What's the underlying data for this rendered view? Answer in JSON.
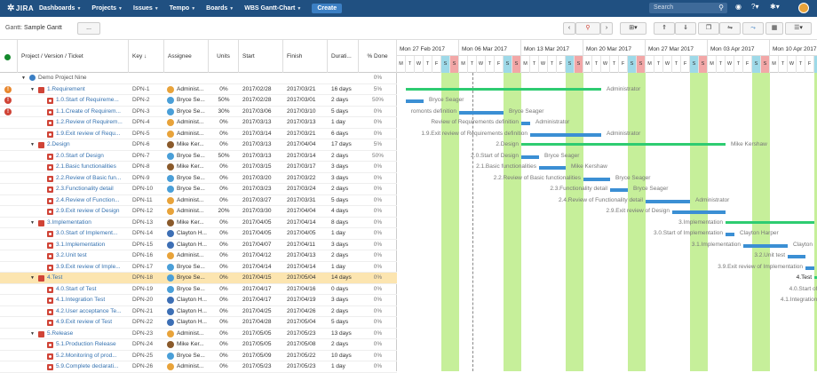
{
  "nav": {
    "logo": "JIRA",
    "items": [
      "Dashboards",
      "Projects",
      "Issues",
      "Tempo",
      "Boards",
      "WBS Gantt-Chart"
    ],
    "create": "Create",
    "search_placeholder": "Search"
  },
  "toolbar": {
    "gantt_label": "Gantt:",
    "gantt_name": "Sample Gantt",
    "dropdown": "..."
  },
  "columns": {
    "project": "Project / Version / Ticket",
    "key": "Key",
    "sort": "↓",
    "assignee": "Assignee",
    "units": "Units",
    "start": "Start",
    "finish": "Finish",
    "duration": "Durati...",
    "done": "% Done"
  },
  "weeks": [
    "Mon 27 Feb 2017",
    "Mon 06 Mar 2017",
    "Mon 13 Mar 2017",
    "Mon 20 Mar 2017",
    "Mon 27 Mar 2017",
    "Mon 03 Apr 2017",
    "Mon 10 Apr 2017"
  ],
  "day_letters": [
    "M",
    "T",
    "W",
    "T",
    "F",
    "S",
    "S"
  ],
  "colors": {
    "nav": "#205081",
    "weekend": "#c6ef9a",
    "task_bar": "#3b8fd4",
    "summary_bar": "#2ecc71",
    "selected": "#fce5b0"
  },
  "rows": [
    {
      "name": "Demo Project Nine",
      "key": "",
      "assignee": "",
      "units": "",
      "start": "",
      "finish": "",
      "duration": "",
      "done": "0%",
      "level": 0,
      "kind": "project",
      "warn": ""
    },
    {
      "name": "1.Requirement",
      "key": "DPN-1",
      "assignee": "Administ...",
      "units": "0%",
      "start": "2017/02/28",
      "finish": "2017/03/21",
      "duration": "16 days",
      "done": "5%",
      "level": 1,
      "kind": "epic",
      "warn": "o"
    },
    {
      "name": "1.0.Start of Requireme...",
      "key": "DPN-2",
      "assignee": "Bryce Se...",
      "units": "50%",
      "start": "2017/02/28",
      "finish": "2017/03/01",
      "duration": "2 days",
      "done": "50%",
      "level": 2,
      "kind": "issue",
      "warn": "r"
    },
    {
      "name": "1.1.Create of Requirem...",
      "key": "DPN-3",
      "assignee": "Bryce Se...",
      "units": "30%",
      "start": "2017/03/06",
      "finish": "2017/03/10",
      "duration": "5 days",
      "done": "0%",
      "level": 2,
      "kind": "issue",
      "warn": "r"
    },
    {
      "name": "1.2.Review of Requirem...",
      "key": "DPN-4",
      "assignee": "Administ...",
      "units": "0%",
      "start": "2017/03/13",
      "finish": "2017/03/13",
      "duration": "1 day",
      "done": "0%",
      "level": 2,
      "kind": "issue",
      "warn": ""
    },
    {
      "name": "1.9.Exit review of Requ...",
      "key": "DPN-5",
      "assignee": "Administ...",
      "units": "0%",
      "start": "2017/03/14",
      "finish": "2017/03/21",
      "duration": "6 days",
      "done": "0%",
      "level": 2,
      "kind": "issue",
      "warn": ""
    },
    {
      "name": "2.Design",
      "key": "DPN-6",
      "assignee": "Mike Ker...",
      "units": "0%",
      "start": "2017/03/13",
      "finish": "2017/04/04",
      "duration": "17 days",
      "done": "5%",
      "level": 1,
      "kind": "epic",
      "warn": ""
    },
    {
      "name": "2.0.Start of Design",
      "key": "DPN-7",
      "assignee": "Bryce Se...",
      "units": "50%",
      "start": "2017/03/13",
      "finish": "2017/03/14",
      "duration": "2 days",
      "done": "50%",
      "level": 2,
      "kind": "issue",
      "warn": ""
    },
    {
      "name": "2.1.Basic functionalities",
      "key": "DPN-8",
      "assignee": "Mike Ker...",
      "units": "0%",
      "start": "2017/03/15",
      "finish": "2017/03/17",
      "duration": "3 days",
      "done": "0%",
      "level": 2,
      "kind": "issue",
      "warn": ""
    },
    {
      "name": "2.2.Review of Basic fun...",
      "key": "DPN-9",
      "assignee": "Bryce Se...",
      "units": "0%",
      "start": "2017/03/20",
      "finish": "2017/03/22",
      "duration": "3 days",
      "done": "0%",
      "level": 2,
      "kind": "issue",
      "warn": ""
    },
    {
      "name": "2.3.Functionality detail",
      "key": "DPN-10",
      "assignee": "Bryce Se...",
      "units": "0%",
      "start": "2017/03/23",
      "finish": "2017/03/24",
      "duration": "2 days",
      "done": "0%",
      "level": 2,
      "kind": "issue",
      "warn": ""
    },
    {
      "name": "2.4.Review of Function...",
      "key": "DPN-11",
      "assignee": "Administ...",
      "units": "0%",
      "start": "2017/03/27",
      "finish": "2017/03/31",
      "duration": "5 days",
      "done": "0%",
      "level": 2,
      "kind": "issue",
      "warn": ""
    },
    {
      "name": "2.9.Exit review of Design",
      "key": "DPN-12",
      "assignee": "Administ...",
      "units": "20%",
      "start": "2017/03/30",
      "finish": "2017/04/04",
      "duration": "4 days",
      "done": "0%",
      "level": 2,
      "kind": "issue",
      "warn": ""
    },
    {
      "name": "3.Implementation",
      "key": "DPN-13",
      "assignee": "Mike Ker...",
      "units": "0%",
      "start": "2017/04/05",
      "finish": "2017/04/14",
      "duration": "8 days",
      "done": "0%",
      "level": 1,
      "kind": "epic",
      "warn": ""
    },
    {
      "name": "3.0.Start of Implement...",
      "key": "DPN-14",
      "assignee": "Clayton H...",
      "units": "0%",
      "start": "2017/04/05",
      "finish": "2017/04/05",
      "duration": "1 day",
      "done": "0%",
      "level": 2,
      "kind": "issue",
      "warn": ""
    },
    {
      "name": "3.1.Implementation",
      "key": "DPN-15",
      "assignee": "Clayton H...",
      "units": "0%",
      "start": "2017/04/07",
      "finish": "2017/04/11",
      "duration": "3 days",
      "done": "0%",
      "level": 2,
      "kind": "issue",
      "warn": ""
    },
    {
      "name": "3.2.Unit test",
      "key": "DPN-16",
      "assignee": "Administ...",
      "units": "0%",
      "start": "2017/04/12",
      "finish": "2017/04/13",
      "duration": "2 days",
      "done": "0%",
      "level": 2,
      "kind": "issue",
      "warn": ""
    },
    {
      "name": "3.9.Exit review of Imple...",
      "key": "DPN-17",
      "assignee": "Bryce Se...",
      "units": "0%",
      "start": "2017/04/14",
      "finish": "2017/04/14",
      "duration": "1 day",
      "done": "0%",
      "level": 2,
      "kind": "issue",
      "warn": ""
    },
    {
      "name": "4.Test",
      "key": "DPN-18",
      "assignee": "Bryce Se...",
      "units": "0%",
      "start": "2017/04/15",
      "finish": "2017/05/04",
      "duration": "14 days",
      "done": "0%",
      "level": 1,
      "kind": "epic",
      "warn": "",
      "selected": true
    },
    {
      "name": "4.0.Start of Test",
      "key": "DPN-19",
      "assignee": "Bryce Se...",
      "units": "0%",
      "start": "2017/04/17",
      "finish": "2017/04/16",
      "duration": "0 days",
      "done": "0%",
      "level": 2,
      "kind": "issue",
      "warn": ""
    },
    {
      "name": "4.1.Integration Test",
      "key": "DPN-20",
      "assignee": "Clayton H...",
      "units": "0%",
      "start": "2017/04/17",
      "finish": "2017/04/19",
      "duration": "3 days",
      "done": "0%",
      "level": 2,
      "kind": "issue",
      "warn": ""
    },
    {
      "name": "4.2.User acceptance Te...",
      "key": "DPN-21",
      "assignee": "Clayton H...",
      "units": "0%",
      "start": "2017/04/25",
      "finish": "2017/04/26",
      "duration": "2 days",
      "done": "0%",
      "level": 2,
      "kind": "issue",
      "warn": ""
    },
    {
      "name": "4.9.Exit review of Test",
      "key": "DPN-22",
      "assignee": "Clayton H...",
      "units": "0%",
      "start": "2017/04/28",
      "finish": "2017/05/04",
      "duration": "5 days",
      "done": "0%",
      "level": 2,
      "kind": "issue",
      "warn": ""
    },
    {
      "name": "5.Release",
      "key": "DPN-23",
      "assignee": "Administ...",
      "units": "0%",
      "start": "2017/05/05",
      "finish": "2017/05/23",
      "duration": "13 days",
      "done": "0%",
      "level": 1,
      "kind": "epic",
      "warn": ""
    },
    {
      "name": "5.1.Production Release",
      "key": "DPN-24",
      "assignee": "Mike Ker...",
      "units": "0%",
      "start": "2017/05/05",
      "finish": "2017/05/08",
      "duration": "2 days",
      "done": "0%",
      "level": 2,
      "kind": "issue",
      "warn": ""
    },
    {
      "name": "5.2.Monitoring of prod...",
      "key": "DPN-25",
      "assignee": "Bryce Se...",
      "units": "0%",
      "start": "2017/05/09",
      "finish": "2017/05/22",
      "duration": "10 days",
      "done": "0%",
      "level": 2,
      "kind": "issue",
      "warn": ""
    },
    {
      "name": "5.9.Complete declarati...",
      "key": "DPN-26",
      "assignee": "Administ...",
      "units": "0%",
      "start": "2017/05/23",
      "finish": "2017/05/23",
      "duration": "1 day",
      "done": "0%",
      "level": 2,
      "kind": "issue",
      "warn": ""
    }
  ],
  "gantt_labels": [
    {
      "row": 1,
      "text": "Administrator"
    },
    {
      "row": 2,
      "text": "Bryce Seager"
    },
    {
      "row": 3,
      "text": "Bryce Seager"
    },
    {
      "row": 4,
      "text": "Administrator"
    },
    {
      "row": 5,
      "text": "Administrator"
    },
    {
      "row": 6,
      "text": "Mike Kershaw"
    },
    {
      "row": 7,
      "text": "Bryce Seager"
    },
    {
      "row": 8,
      "text": "Mike Kershaw"
    },
    {
      "row": 9,
      "text": "Bryce Seager"
    },
    {
      "row": 10,
      "text": "Bryce Seager"
    },
    {
      "row": 11,
      "text": "Administrator"
    },
    {
      "row": 13,
      "text": "Mike Kershaw"
    },
    {
      "row": 14,
      "text": "Clayton Harper"
    },
    {
      "row": 15,
      "text": "Clayton"
    }
  ],
  "gantt_prefix_labels": [
    {
      "row": 3,
      "text": "romonts definition"
    },
    {
      "row": 4,
      "text": "Review of Requirements definition"
    },
    {
      "row": 5,
      "text": "1.9.Exit review of Requirements definition"
    },
    {
      "row": 6,
      "text": "2.Design"
    },
    {
      "row": 7,
      "text": "2.0.Start of Design"
    },
    {
      "row": 8,
      "text": "2.1.Basic functionalities"
    },
    {
      "row": 9,
      "text": "2.2.Review of Basic functionalities"
    },
    {
      "row": 10,
      "text": "2.3.Functionality detail"
    },
    {
      "row": 11,
      "text": "2.4.Review of Functionality detail"
    },
    {
      "row": 12,
      "text": "2.9.Exit review of Design"
    },
    {
      "row": 13,
      "text": "3.Implementation"
    },
    {
      "row": 14,
      "text": "3.0.Start of Implementation"
    },
    {
      "row": 15,
      "text": "3.1.Implementation"
    },
    {
      "row": 16,
      "text": "3.2.Unit test"
    },
    {
      "row": 17,
      "text": "3.9.Exit review of Implementation"
    },
    {
      "row": 18,
      "text": "4.Test"
    },
    {
      "row": 19,
      "text": "4.0.Start of Test"
    },
    {
      "row": 20,
      "text": "4.1.Integration Test"
    }
  ]
}
